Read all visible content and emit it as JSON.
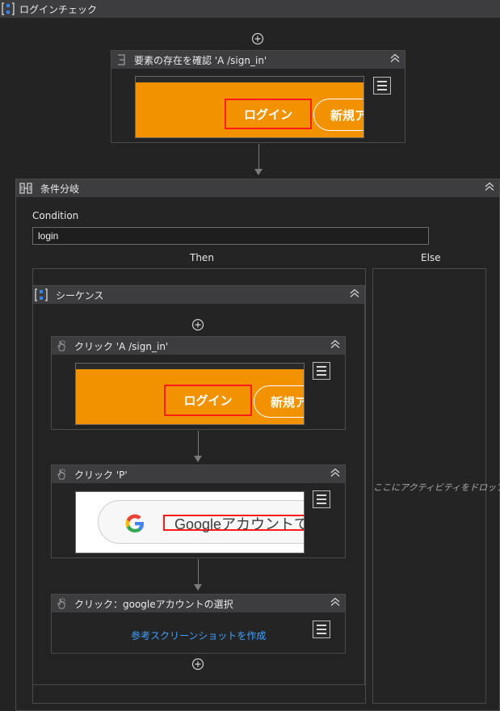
{
  "top_sequence": {
    "title": "ログインチェック"
  },
  "element_exists": {
    "title": "要素の存在を確認 'A  /sign_in'",
    "screenshot": {
      "login_label": "ログイン",
      "new_label": "新規ア"
    }
  },
  "if_activity": {
    "title": "条件分岐",
    "condition_label": "Condition",
    "condition_value": "login",
    "then_label": "Then",
    "else_label": "Else",
    "else_drop_hint": "ここにアクティビティをドロップ"
  },
  "inner_sequence": {
    "title": "シーケンス"
  },
  "click_signin": {
    "title": "クリック 'A  /sign_in'",
    "screenshot": {
      "login_label": "ログイン",
      "new_label": "新規ア"
    }
  },
  "click_p": {
    "title": "クリック 'P'",
    "screenshot": {
      "google_text": "Googleアカウントで"
    }
  },
  "click_google": {
    "title": "クリック：googleアカウントの選択",
    "capture_link": "参考スクリーンショットを作成"
  },
  "colors": {
    "accent_orange": "#f39200",
    "highlight_red": "#ff1a1a",
    "link_blue": "#3fa0ff"
  }
}
